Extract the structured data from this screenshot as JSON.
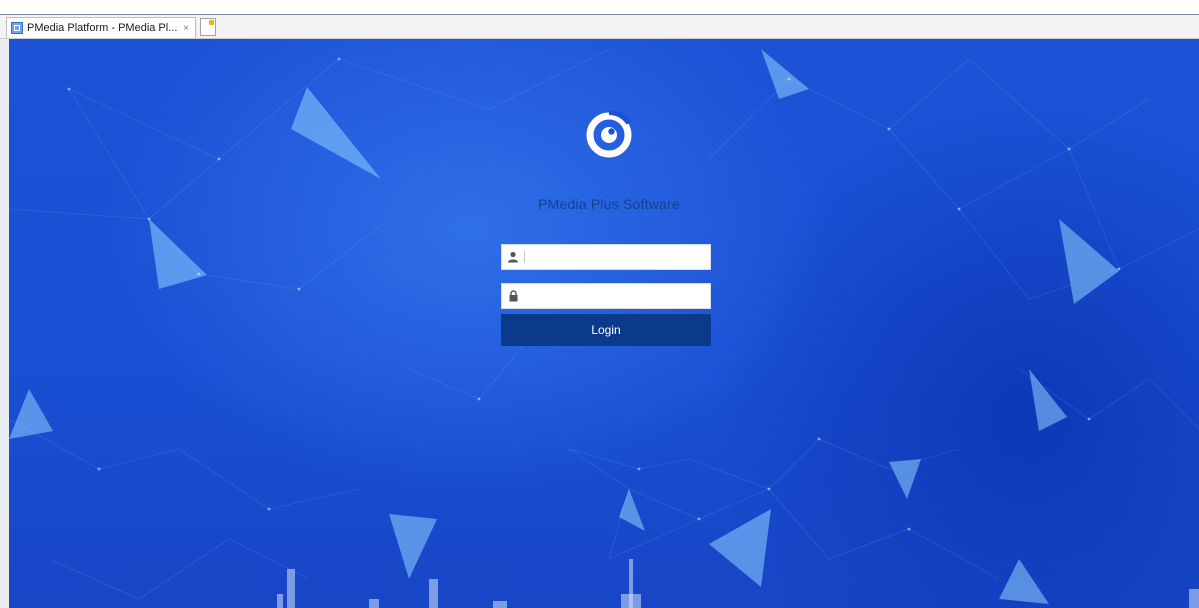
{
  "browser": {
    "tab_title": "PMedia Platform - PMedia Pl...",
    "tab_close": "×"
  },
  "login": {
    "brand_name": "PMedia Plus Software",
    "username_value": "",
    "password_value": "",
    "login_label": "Login"
  },
  "theme": {
    "background": "#1a4fd4",
    "button": "#0b3a8a",
    "brand_text": "#164192"
  },
  "icons": [
    "browser-tab-favicon",
    "new-tab-icon",
    "app-logo-icon",
    "user-icon",
    "lock-icon"
  ]
}
